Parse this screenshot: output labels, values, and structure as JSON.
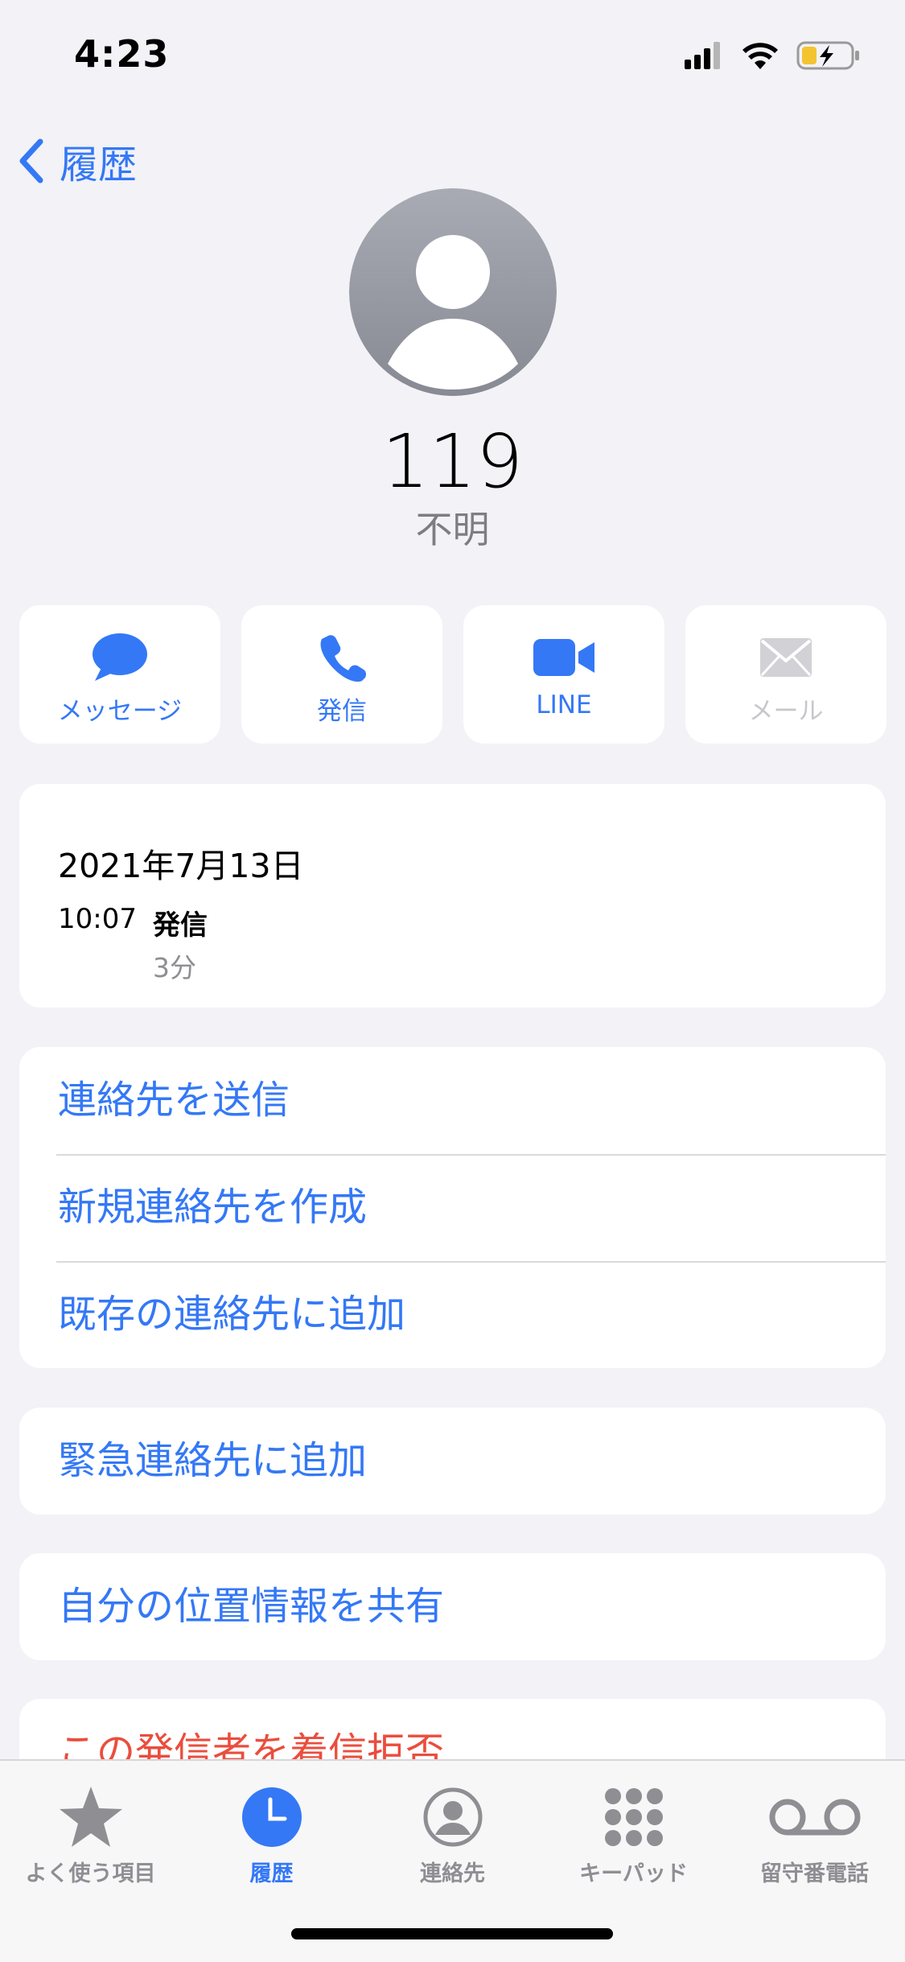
{
  "status": {
    "time": "4:23"
  },
  "nav": {
    "back_label": "履歴"
  },
  "contact": {
    "number": "119",
    "label": "不明"
  },
  "actions": [
    {
      "label": "メッセージ",
      "icon": "message-bubble-icon",
      "enabled": true
    },
    {
      "label": "発信",
      "icon": "phone-icon",
      "enabled": true
    },
    {
      "label": "LINE",
      "icon": "video-icon",
      "enabled": true
    },
    {
      "label": "メール",
      "icon": "mail-icon",
      "enabled": false
    }
  ],
  "history": {
    "date": "2021年7月13日",
    "time": "10:07",
    "type": "発信",
    "duration": "3分"
  },
  "options": {
    "group1": [
      "連絡先を送信",
      "新規連絡先を作成",
      "既存の連絡先に追加"
    ],
    "emergency": "緊急連絡先に追加",
    "share_location": "自分の位置情報を共有",
    "block": "この発信者を着信拒否"
  },
  "tabs": [
    {
      "label": "よく使う項目",
      "icon": "star-icon",
      "active": false
    },
    {
      "label": "履歴",
      "icon": "clock-icon",
      "active": true
    },
    {
      "label": "連絡先",
      "icon": "person-circle-icon",
      "active": false
    },
    {
      "label": "キーパッド",
      "icon": "keypad-icon",
      "active": false
    },
    {
      "label": "留守番電話",
      "icon": "voicemail-icon",
      "active": false
    }
  ],
  "colors": {
    "accent": "#3478f6",
    "danger": "#eb4d3d",
    "background": "#f2f2f7"
  }
}
